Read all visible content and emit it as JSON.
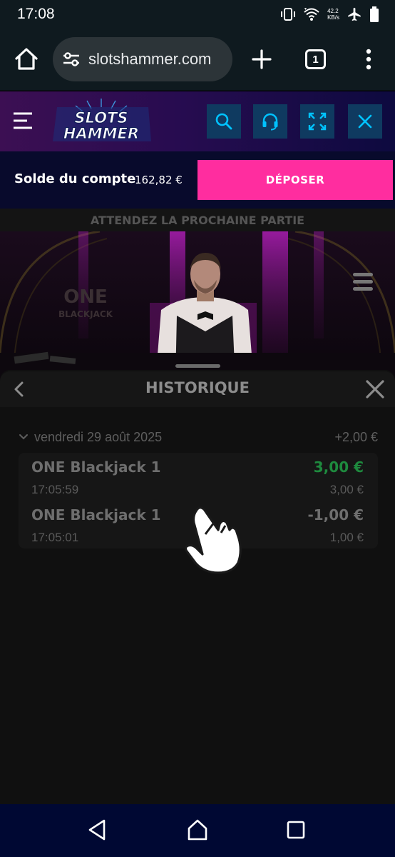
{
  "status_bar": {
    "time": "17:08",
    "net_speed_value": "42.2",
    "net_speed_unit": "KB/s",
    "icons": [
      "vibrate-icon",
      "wifi-icon",
      "airplane-icon",
      "battery-icon"
    ]
  },
  "browser": {
    "url": "slotshammer.com",
    "tab_count": "1",
    "icons": [
      "home-icon",
      "site-settings-icon",
      "new-tab-icon",
      "more-vert-icon"
    ]
  },
  "site": {
    "logo_line1": "SLOTS",
    "logo_line2": "HAMMER",
    "buttons": [
      "search-icon",
      "headset-icon",
      "fullscreen-icon",
      "close-icon"
    ],
    "colors": {
      "header_start": "#3c0f53",
      "header_end": "#0d0a3f",
      "button_bg": "#0f3a60",
      "button_icon": "#00c2ff"
    }
  },
  "account": {
    "balance_label": "Solde du compte",
    "balance_value": "162,82 €",
    "deposit_label": "DÉPOSER",
    "deposit_color": "#ff2d9f"
  },
  "game": {
    "banner": "ATTENDEZ LA PROCHAINE PARTIE",
    "table_logo_line1": "ONE",
    "table_logo_line2": "BLACKJACK"
  },
  "history": {
    "title": "HISTORIQUE",
    "day": {
      "date": "vendredi 29 août 2025",
      "total": "+2,00 €",
      "transactions": [
        {
          "game": "ONE Blackjack 1",
          "time": "17:05:59",
          "result": "3,00 €",
          "stake": "3,00 €",
          "result_color": "#1e8a3e"
        },
        {
          "game": "ONE Blackjack 1",
          "time": "17:05:01",
          "result": "-1,00 €",
          "stake": "1,00 €",
          "result_color": "#6e6e6e"
        }
      ]
    }
  },
  "nav_bar": {
    "icons": [
      "back-icon",
      "home-icon",
      "recents-icon"
    ]
  }
}
